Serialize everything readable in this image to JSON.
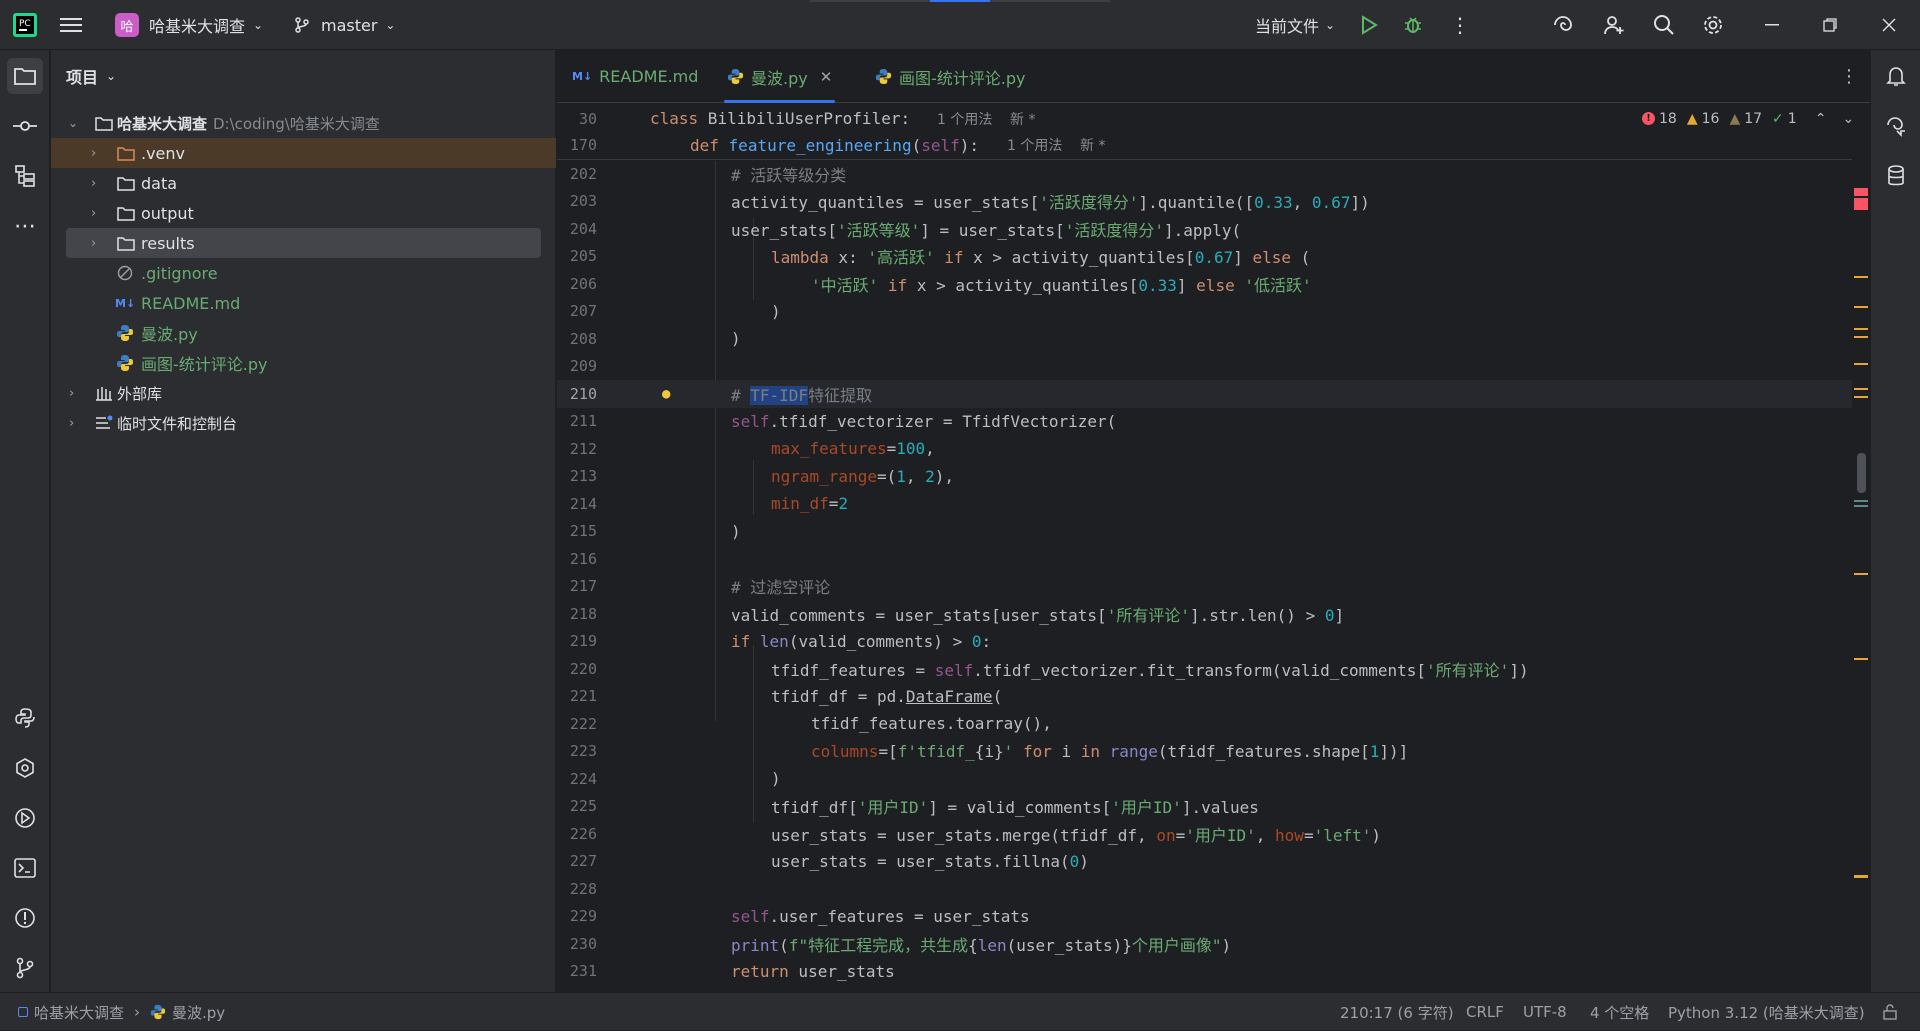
{
  "titlebar": {
    "project_badge": "哈",
    "project_name": "哈基米大调查",
    "branch": "master",
    "run_config": "当前文件"
  },
  "project_panel": {
    "title": "项目",
    "root_name": "哈基米大调查",
    "root_path": "D:\\coding\\哈基米大调查",
    "items": [
      {
        "label": ".venv"
      },
      {
        "label": "data"
      },
      {
        "label": "output"
      },
      {
        "label": "results"
      },
      {
        "label": ".gitignore"
      },
      {
        "label": "README.md"
      },
      {
        "label": "曼波.py"
      },
      {
        "label": "画图-统计评论.py"
      },
      {
        "label": "外部库"
      },
      {
        "label": "临时文件和控制台"
      }
    ]
  },
  "tabs": [
    {
      "label": "README.md"
    },
    {
      "label": "曼波.py"
    },
    {
      "label": "画图-统计评论.py"
    }
  ],
  "sticky": [
    {
      "ln": "30",
      "usage": "1 个用法",
      "new": "新 *"
    },
    {
      "ln": "170",
      "usage": "1 个用法",
      "new": "新 *"
    }
  ],
  "inspections": {
    "errors": "18",
    "warnings": "16",
    "weak": "17",
    "ok": "1"
  },
  "line_numbers": [
    "202",
    "203",
    "204",
    "205",
    "206",
    "207",
    "208",
    "209",
    "210",
    "211",
    "212",
    "213",
    "214",
    "215",
    "216",
    "217",
    "218",
    "219",
    "220",
    "221",
    "222",
    "223",
    "224",
    "225",
    "226",
    "227",
    "228",
    "229",
    "230",
    "231"
  ],
  "status": {
    "crumb_project": "哈基米大调查",
    "crumb_file": "曼波.py",
    "position": "210:17 (6 字符)",
    "line_sep": "CRLF",
    "encoding": "UTF-8",
    "indent": "4 个空格",
    "interpreter": "Python 3.12 (哈基米大调查)"
  },
  "colors": {
    "accent": "#3574f0",
    "error": "#f75464",
    "warning": "#e5a734",
    "ok": "#5fb865"
  }
}
